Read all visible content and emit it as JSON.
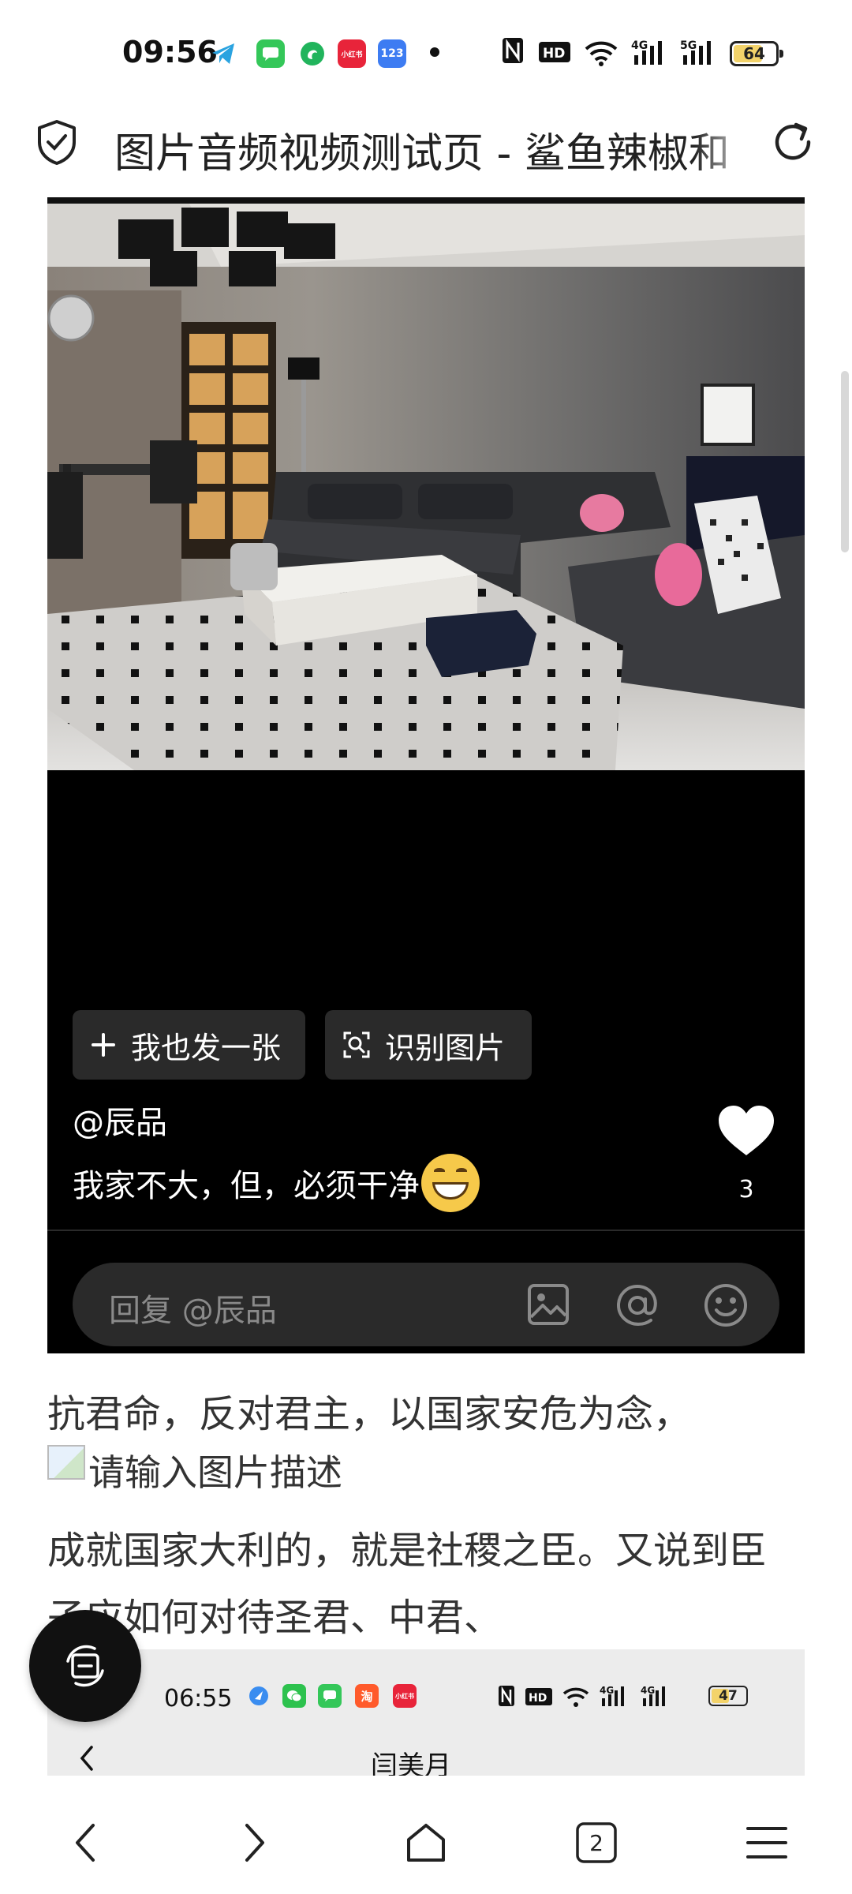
{
  "status_bar": {
    "time": "09:56",
    "apps": [
      {
        "icon": "telegram-icon",
        "color": "#2aa3e0"
      },
      {
        "icon": "messages-icon",
        "color": "#34c759"
      },
      {
        "icon": "green-app-icon",
        "color": "#21b45c"
      },
      {
        "icon": "xiaohongshu-icon",
        "color": "#e8243a",
        "label": "小红书"
      },
      {
        "icon": "123-app-icon",
        "color": "#3d7cf2",
        "label": "123"
      }
    ],
    "nfc": "N",
    "hd": "HD",
    "net1": "4G",
    "net2": "5G",
    "battery": "64"
  },
  "browser": {
    "title": "图片音频视频测试页 - 鲨鱼辣椒和"
  },
  "post": {
    "post_button": "我也发一张",
    "recognize_button": "识别图片",
    "author": "@辰品",
    "caption": "我家不大，但，必须干净",
    "likes": "3",
    "reply_placeholder": "回复 @辰品"
  },
  "article": {
    "line1": "抗君命，反对君主，以国家安危为念，",
    "image_alt": "请输入图片描述",
    "line2": "成就国家大利的，就是社稷之臣。又说到臣",
    "line3": "子应如何对待圣君、中君、"
  },
  "nested_screenshot": {
    "time": "06:55",
    "battery": "47",
    "net1": "4G",
    "net2": "4G",
    "hd": "HD",
    "title": "闫美月",
    "apps": [
      {
        "icon": "blue-app-icon",
        "color": "#3a8df0"
      },
      {
        "icon": "wechat-icon",
        "color": "#2dc24e"
      },
      {
        "icon": "messages-icon",
        "color": "#34c759"
      },
      {
        "icon": "taobao-icon",
        "color": "#ff5a2b",
        "label": "淘"
      },
      {
        "icon": "xiaohongshu-icon",
        "color": "#e8243a",
        "label": "小红书"
      }
    ]
  },
  "bottom_nav": {
    "tab_count": "2"
  }
}
